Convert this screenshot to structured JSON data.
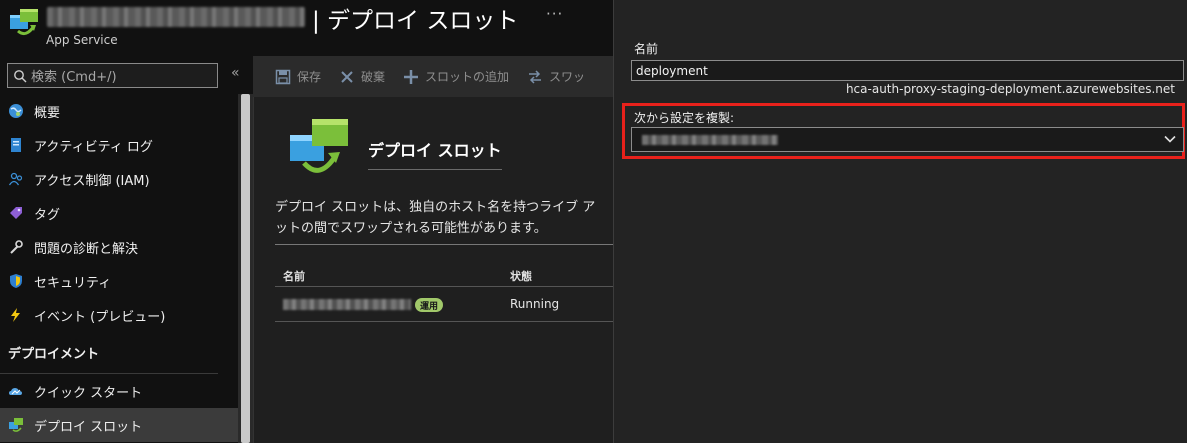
{
  "header": {
    "title": "| デプロイ スロット",
    "subtitle": "App Service",
    "more": "···"
  },
  "sidebar": {
    "search_placeholder": "検索 (Cmd+/)",
    "collapse": "«",
    "items": [
      {
        "label": "概要",
        "icon": "globe-icon"
      },
      {
        "label": "アクティビティ ログ",
        "icon": "activity-log-icon"
      },
      {
        "label": "アクセス制御 (IAM)",
        "icon": "people-icon"
      },
      {
        "label": "タグ",
        "icon": "tag-icon"
      },
      {
        "label": "問題の診断と解決",
        "icon": "wrench-icon"
      },
      {
        "label": "セキュリティ",
        "icon": "shield-icon"
      },
      {
        "label": "イベント (プレビュー)",
        "icon": "lightning-icon"
      }
    ],
    "section": "デプロイメント",
    "section_items": [
      {
        "label": "クイック スタート",
        "icon": "cloud-icon"
      },
      {
        "label": "デプロイ スロット",
        "icon": "deployment-slots-icon"
      }
    ]
  },
  "toolbar": {
    "save": "保存",
    "discard": "破棄",
    "add_slot": "スロットの追加",
    "swap": "スワッ"
  },
  "main": {
    "title": "デプロイ スロット",
    "description_line1": "デプロイ スロットは、独自のホスト名を持つライブ ア",
    "description_line2": "ットの間でスワップされる可能性があります。",
    "col_name": "名前",
    "col_status": "状態",
    "row_badge": "運用",
    "row_status": "Running"
  },
  "panel": {
    "name_label": "名前",
    "name_value": "deployment",
    "hostname": "hca-auth-proxy-staging-deployment.azurewebsites.net",
    "clone_label": "次から設定を複製:"
  },
  "colors": {
    "highlight": "#e8211b",
    "badge": "#a1c86a",
    "accent_blue": "#0078d4"
  }
}
